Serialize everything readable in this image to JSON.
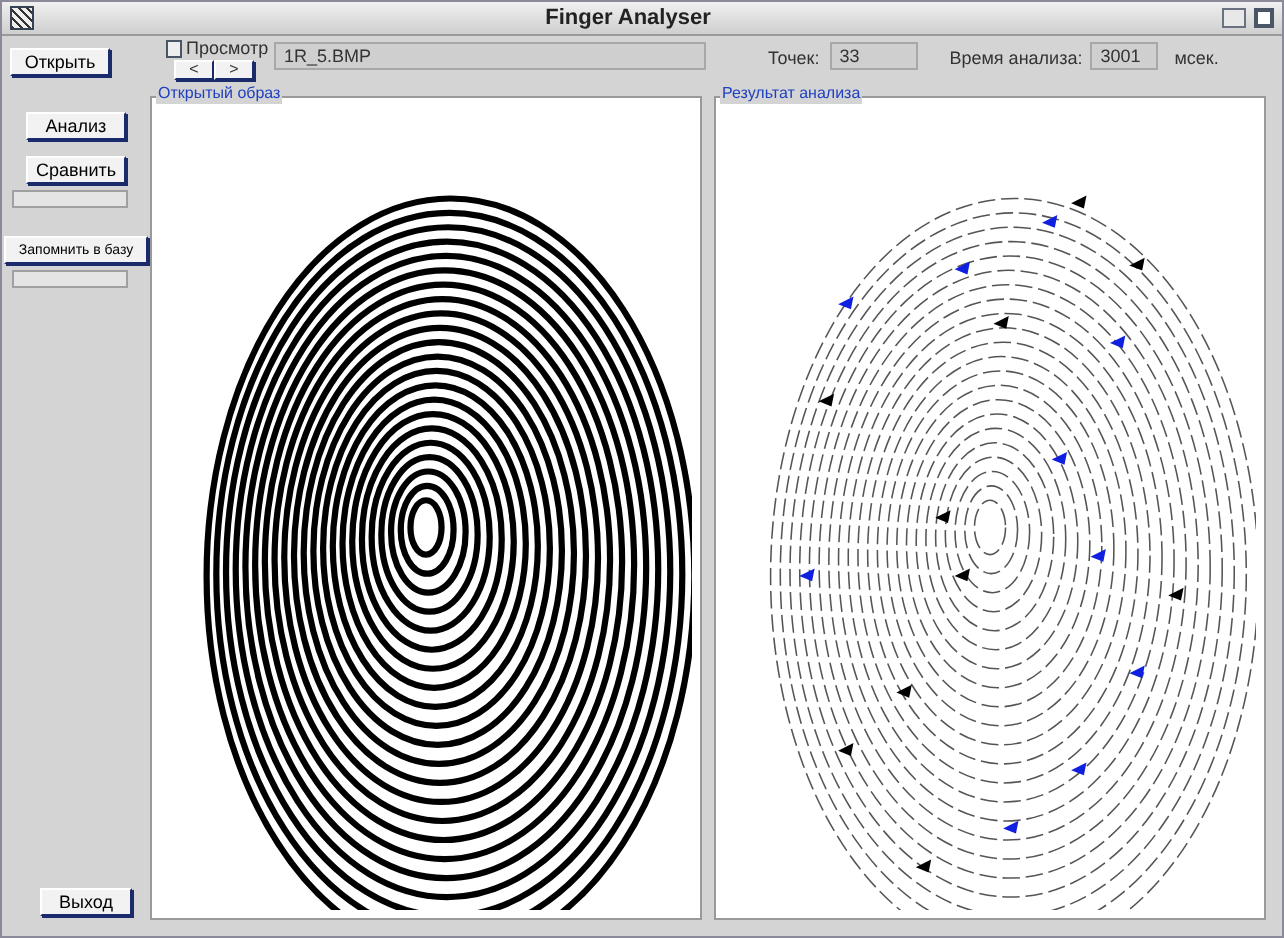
{
  "window": {
    "title": "Finger Analyser"
  },
  "toolbar": {
    "open_button": "Открыть",
    "preview_checkbox": {
      "label": "Просмотр",
      "checked": false
    },
    "prev_button": "<",
    "next_button": ">",
    "file_name": "1R_5.BMP",
    "points_label": "Точек:",
    "points_value": "33",
    "time_label": "Время анализа:",
    "time_value": "3001",
    "time_unit": "мсек."
  },
  "sidebar": {
    "buttons": [
      {
        "label": "Анализ"
      },
      {
        "label": "Сравнить",
        "progress": {
          "level": 0
        }
      },
      {
        "label": "Запомнить в базу",
        "progress": {
          "level": 0
        }
      }
    ],
    "exit_button": "Выход"
  },
  "panels": [
    {
      "title": "Открытый образ"
    },
    {
      "title": "Результат анализа"
    }
  ]
}
